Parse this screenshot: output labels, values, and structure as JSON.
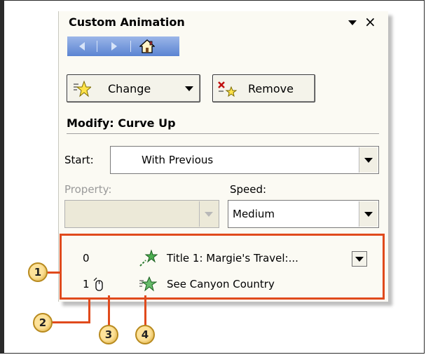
{
  "pane": {
    "title": "Custom Animation",
    "close_glyph": "×",
    "nav": {
      "back_icon": "back-arrow-icon",
      "forward_icon": "forward-arrow-icon",
      "home_icon": "home-icon"
    }
  },
  "buttons": {
    "change_label": "Change",
    "remove_label": "Remove"
  },
  "modify": {
    "heading": "Modify: Curve Up",
    "start_label": "Start:",
    "start_value": "With Previous",
    "property_label": "Property:",
    "property_value": "",
    "speed_label": "Speed:",
    "speed_value": "Medium"
  },
  "animation_list": [
    {
      "order": "0",
      "text": "Title 1: Margie's Travel:..."
    },
    {
      "order": "1",
      "text": "See Canyon Country"
    }
  ],
  "callouts": [
    "1",
    "2",
    "3",
    "4"
  ],
  "colors": {
    "callout_line": "#e04a1c",
    "callout_fill": "#fde29a",
    "nav_bar": "#5b84d2"
  }
}
